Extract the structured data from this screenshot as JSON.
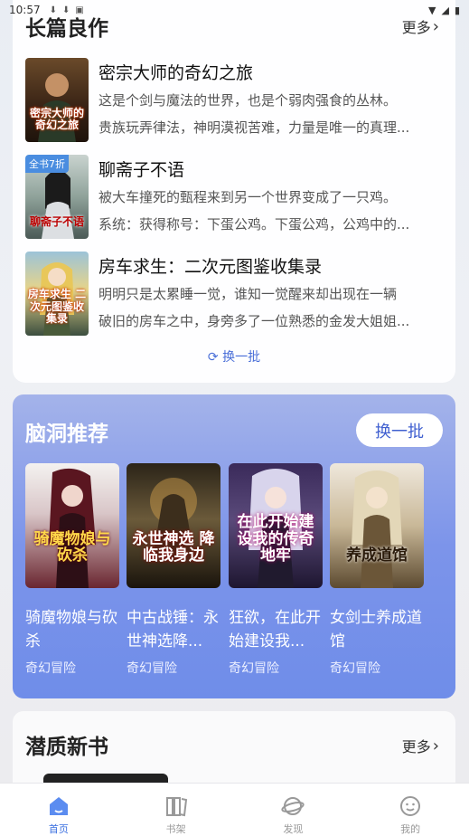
{
  "status_bar": {
    "time": "10:57"
  },
  "section1": {
    "title": "长篇良作",
    "more": "更多",
    "books": [
      {
        "title": "密宗大师的奇幻之旅",
        "desc1": "这是个剑与魔法的世界，也是个弱肉强食的丛林。",
        "desc2": "贵族玩弄律法，神明漠视苦难，力量是唯一的真理...",
        "cover_text": "密宗大师的奇幻之旅",
        "tag": ""
      },
      {
        "title": "聊斋子不语",
        "desc1": "被大车撞死的甄程来到另一个世界变成了一只鸡。",
        "desc2": "系统：获得称号：下蛋公鸡。下蛋公鸡，公鸡中的...",
        "cover_text": "聊斋子不语",
        "tag": "全书7折"
      },
      {
        "title": "房车求生：二次元图鉴收集录",
        "desc1": "明明只是太累睡一觉，谁知一觉醒来却出现在一辆",
        "desc2": "破旧的房车之中，身旁多了一位熟悉的金发大姐姐...",
        "cover_text": "房车求生 二次元图鉴收集录",
        "tag": ""
      }
    ],
    "refresh": "换一批"
  },
  "section2": {
    "title": "脑洞推荐",
    "refresh": "换一批",
    "books": [
      {
        "name": "骑魔物娘与砍杀",
        "category": "奇幻冒险",
        "cover_text": "骑魔物娘与砍杀"
      },
      {
        "name": "中古战锤：永世神选降...",
        "category": "奇幻冒险",
        "cover_text": "永世神选 降临我身边"
      },
      {
        "name": "狂欲，在此开始建设我...",
        "category": "奇幻冒险",
        "cover_text": "在此开始建设我的传奇地牢"
      },
      {
        "name": "女剑士养成道馆",
        "category": "奇幻冒险",
        "cover_text": "养成道馆"
      }
    ]
  },
  "section3": {
    "title": "潜质新书",
    "more": "更多"
  },
  "nav": [
    {
      "label": "首页",
      "icon": "home-icon"
    },
    {
      "label": "书架",
      "icon": "bookshelf-icon"
    },
    {
      "label": "发现",
      "icon": "planet-icon"
    },
    {
      "label": "我的",
      "icon": "profile-icon"
    }
  ],
  "colors": {
    "accent": "#3a6fe0",
    "card2_bg": "#7c94ea"
  }
}
